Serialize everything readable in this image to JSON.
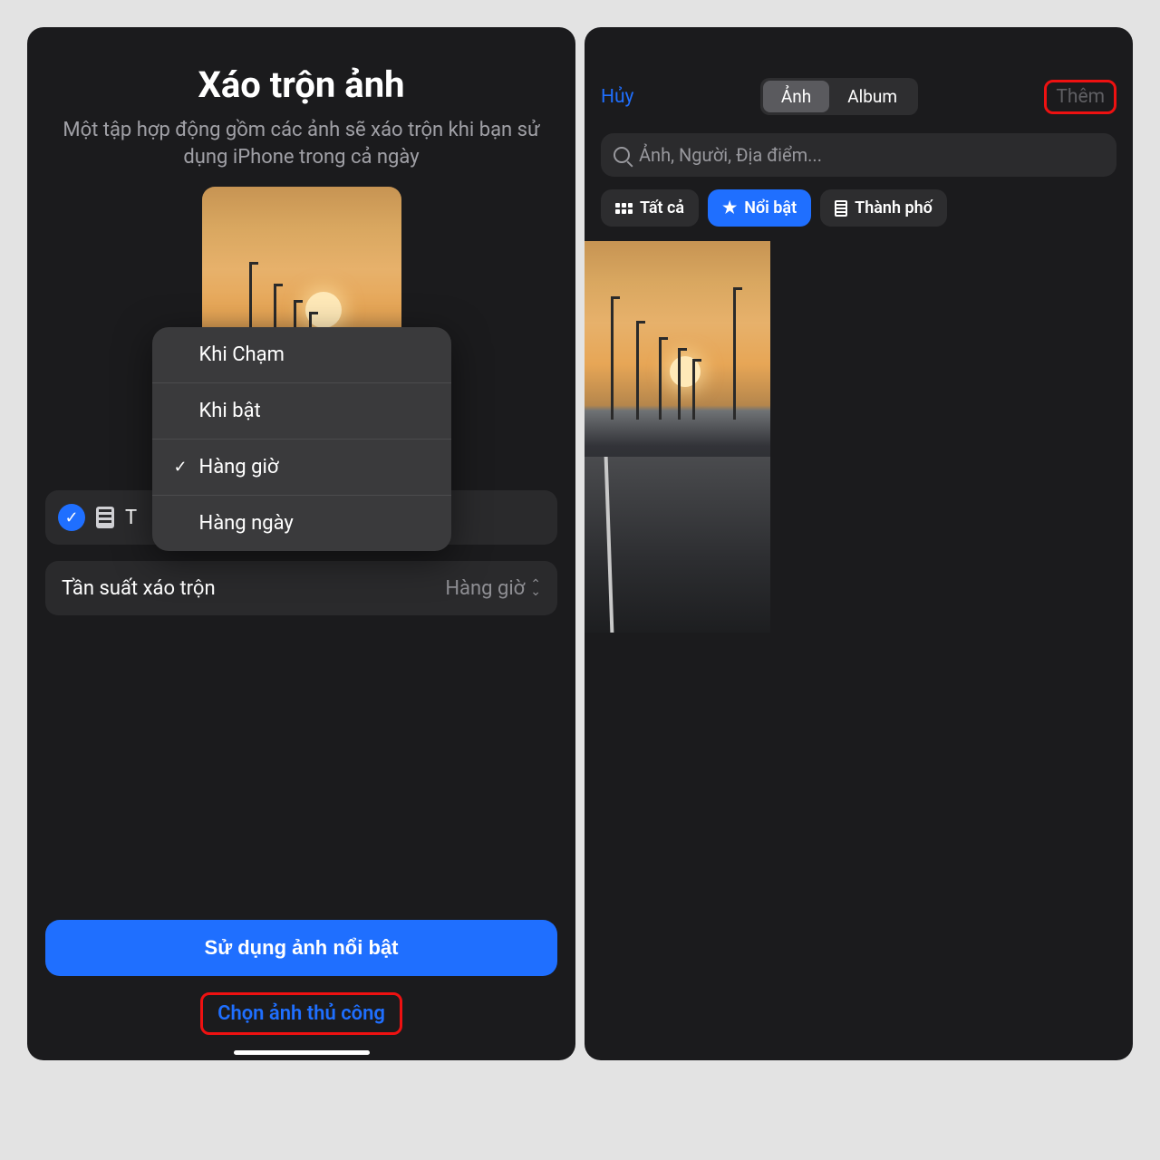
{
  "left": {
    "title": "Xáo trộn ảnh",
    "subtitle": "Một tập hợp động gồm các ảnh sẽ xáo trộn khi bạn sử dụng iPhone trong cả ngày",
    "popover": {
      "items": [
        "Khi Chạm",
        "Khi bật",
        "Hàng giờ",
        "Hàng ngày"
      ],
      "selected_index": 2
    },
    "category_partial_label": "T",
    "freq_label": "Tần suất xáo trộn",
    "freq_value": "Hàng giờ",
    "primary_button": "Sử dụng ảnh nổi bật",
    "secondary_link": "Chọn ảnh thủ công"
  },
  "right": {
    "cancel": "Hủy",
    "segments": {
      "items": [
        "Ảnh",
        "Album"
      ],
      "active_index": 0
    },
    "add": "Thêm",
    "search_placeholder": "Ảnh, Người, Địa điểm...",
    "chips": [
      {
        "label": "Tất cả",
        "icon": "grid",
        "active": false
      },
      {
        "label": "Nổi bật",
        "icon": "star",
        "active": true
      },
      {
        "label": "Thành phố",
        "icon": "building",
        "active": false
      }
    ]
  }
}
